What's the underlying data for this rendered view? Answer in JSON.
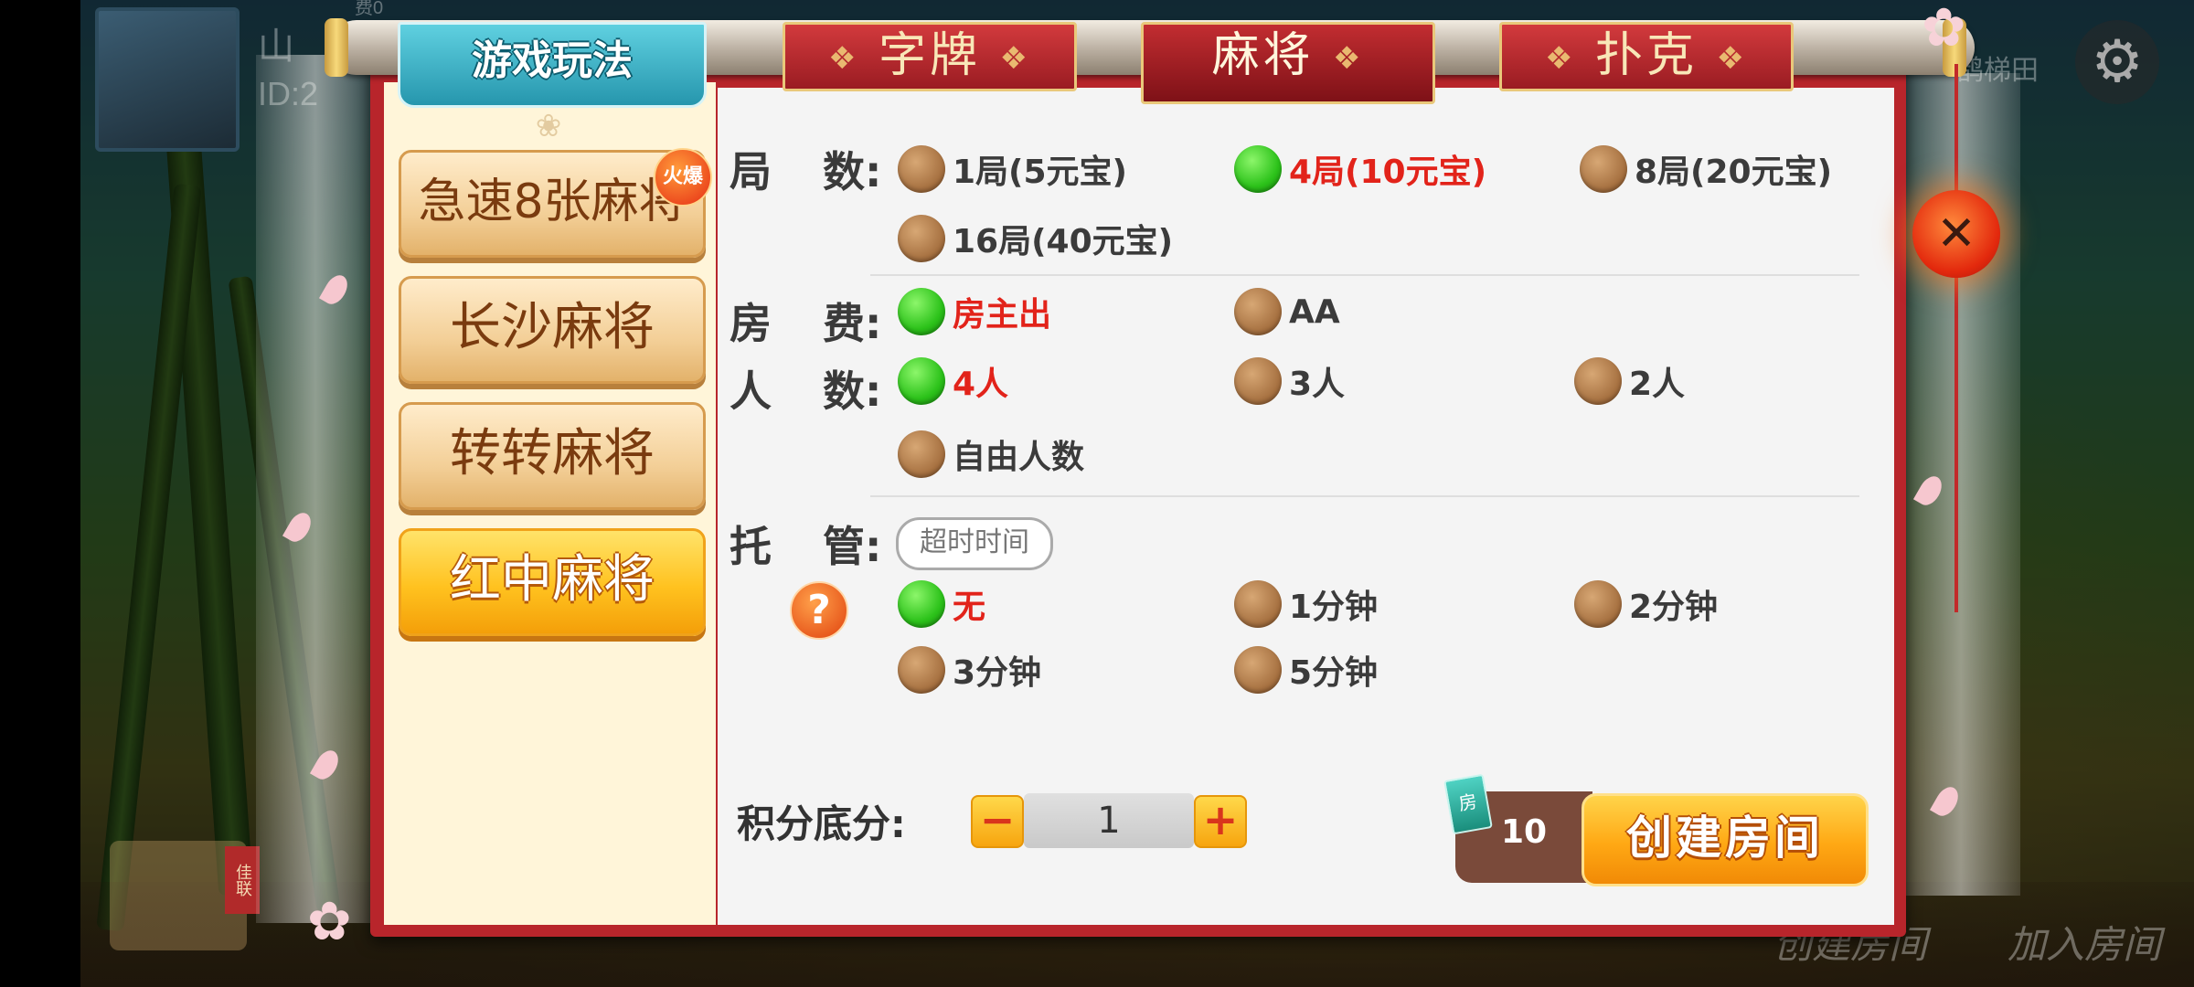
{
  "background": {
    "player_name": "山",
    "player_id": "ID:2",
    "top_badge": "费0",
    "right_button": "鹊梯田",
    "bottom_left_sign": "佳联",
    "bottom_buttons": [
      "创建房间",
      "加入房间"
    ]
  },
  "header": {
    "rules_tab": "游戏玩法",
    "tabs": [
      {
        "label": "字牌",
        "active": false
      },
      {
        "label": "麻将",
        "active": true
      },
      {
        "label": "扑克",
        "active": false
      }
    ]
  },
  "sidebar": {
    "games": [
      {
        "label": "急速8张麻将",
        "active": false,
        "badge": "火爆"
      },
      {
        "label": "长沙麻将",
        "active": false
      },
      {
        "label": "转转麻将",
        "active": false
      },
      {
        "label": "红中麻将",
        "active": true
      }
    ]
  },
  "options": {
    "rounds": {
      "label_a": "局",
      "label_b": "数:",
      "choices": [
        {
          "label": "1局(5元宝)",
          "selected": false
        },
        {
          "label": "4局(10元宝)",
          "selected": true
        },
        {
          "label": "8局(20元宝)",
          "selected": false
        },
        {
          "label": "16局(40元宝)",
          "selected": false
        }
      ]
    },
    "room_fee": {
      "label_a": "房",
      "label_b": "费:",
      "choices": [
        {
          "label": "房主出",
          "selected": true
        },
        {
          "label": "AA",
          "selected": false
        }
      ]
    },
    "players": {
      "label_a": "人",
      "label_b": "数:",
      "choices": [
        {
          "label": "4人",
          "selected": true
        },
        {
          "label": "3人",
          "selected": false
        },
        {
          "label": "2人",
          "selected": false
        },
        {
          "label": "自由人数",
          "selected": false
        }
      ]
    },
    "auto_play": {
      "label_a": "托",
      "label_b": "管:",
      "timeout_pill": "超时时间",
      "help_icon": "?",
      "choices": [
        {
          "label": "无",
          "selected": true
        },
        {
          "label": "1分钟",
          "selected": false
        },
        {
          "label": "2分钟",
          "selected": false
        },
        {
          "label": "3分钟",
          "selected": false
        },
        {
          "label": "5分钟",
          "selected": false
        }
      ]
    }
  },
  "bottom": {
    "score_label": "积分底分:",
    "minus": "−",
    "plus": "+",
    "score_value": "1",
    "room_card_icon": "房",
    "cost": "10",
    "create_button": "创建房间"
  },
  "close_icon": "✕",
  "colors": {
    "frame_red": "#b8252b",
    "selected_green": "#2cc21a",
    "selected_text": "#e2231a",
    "accent_orange": "#f7a50f"
  }
}
